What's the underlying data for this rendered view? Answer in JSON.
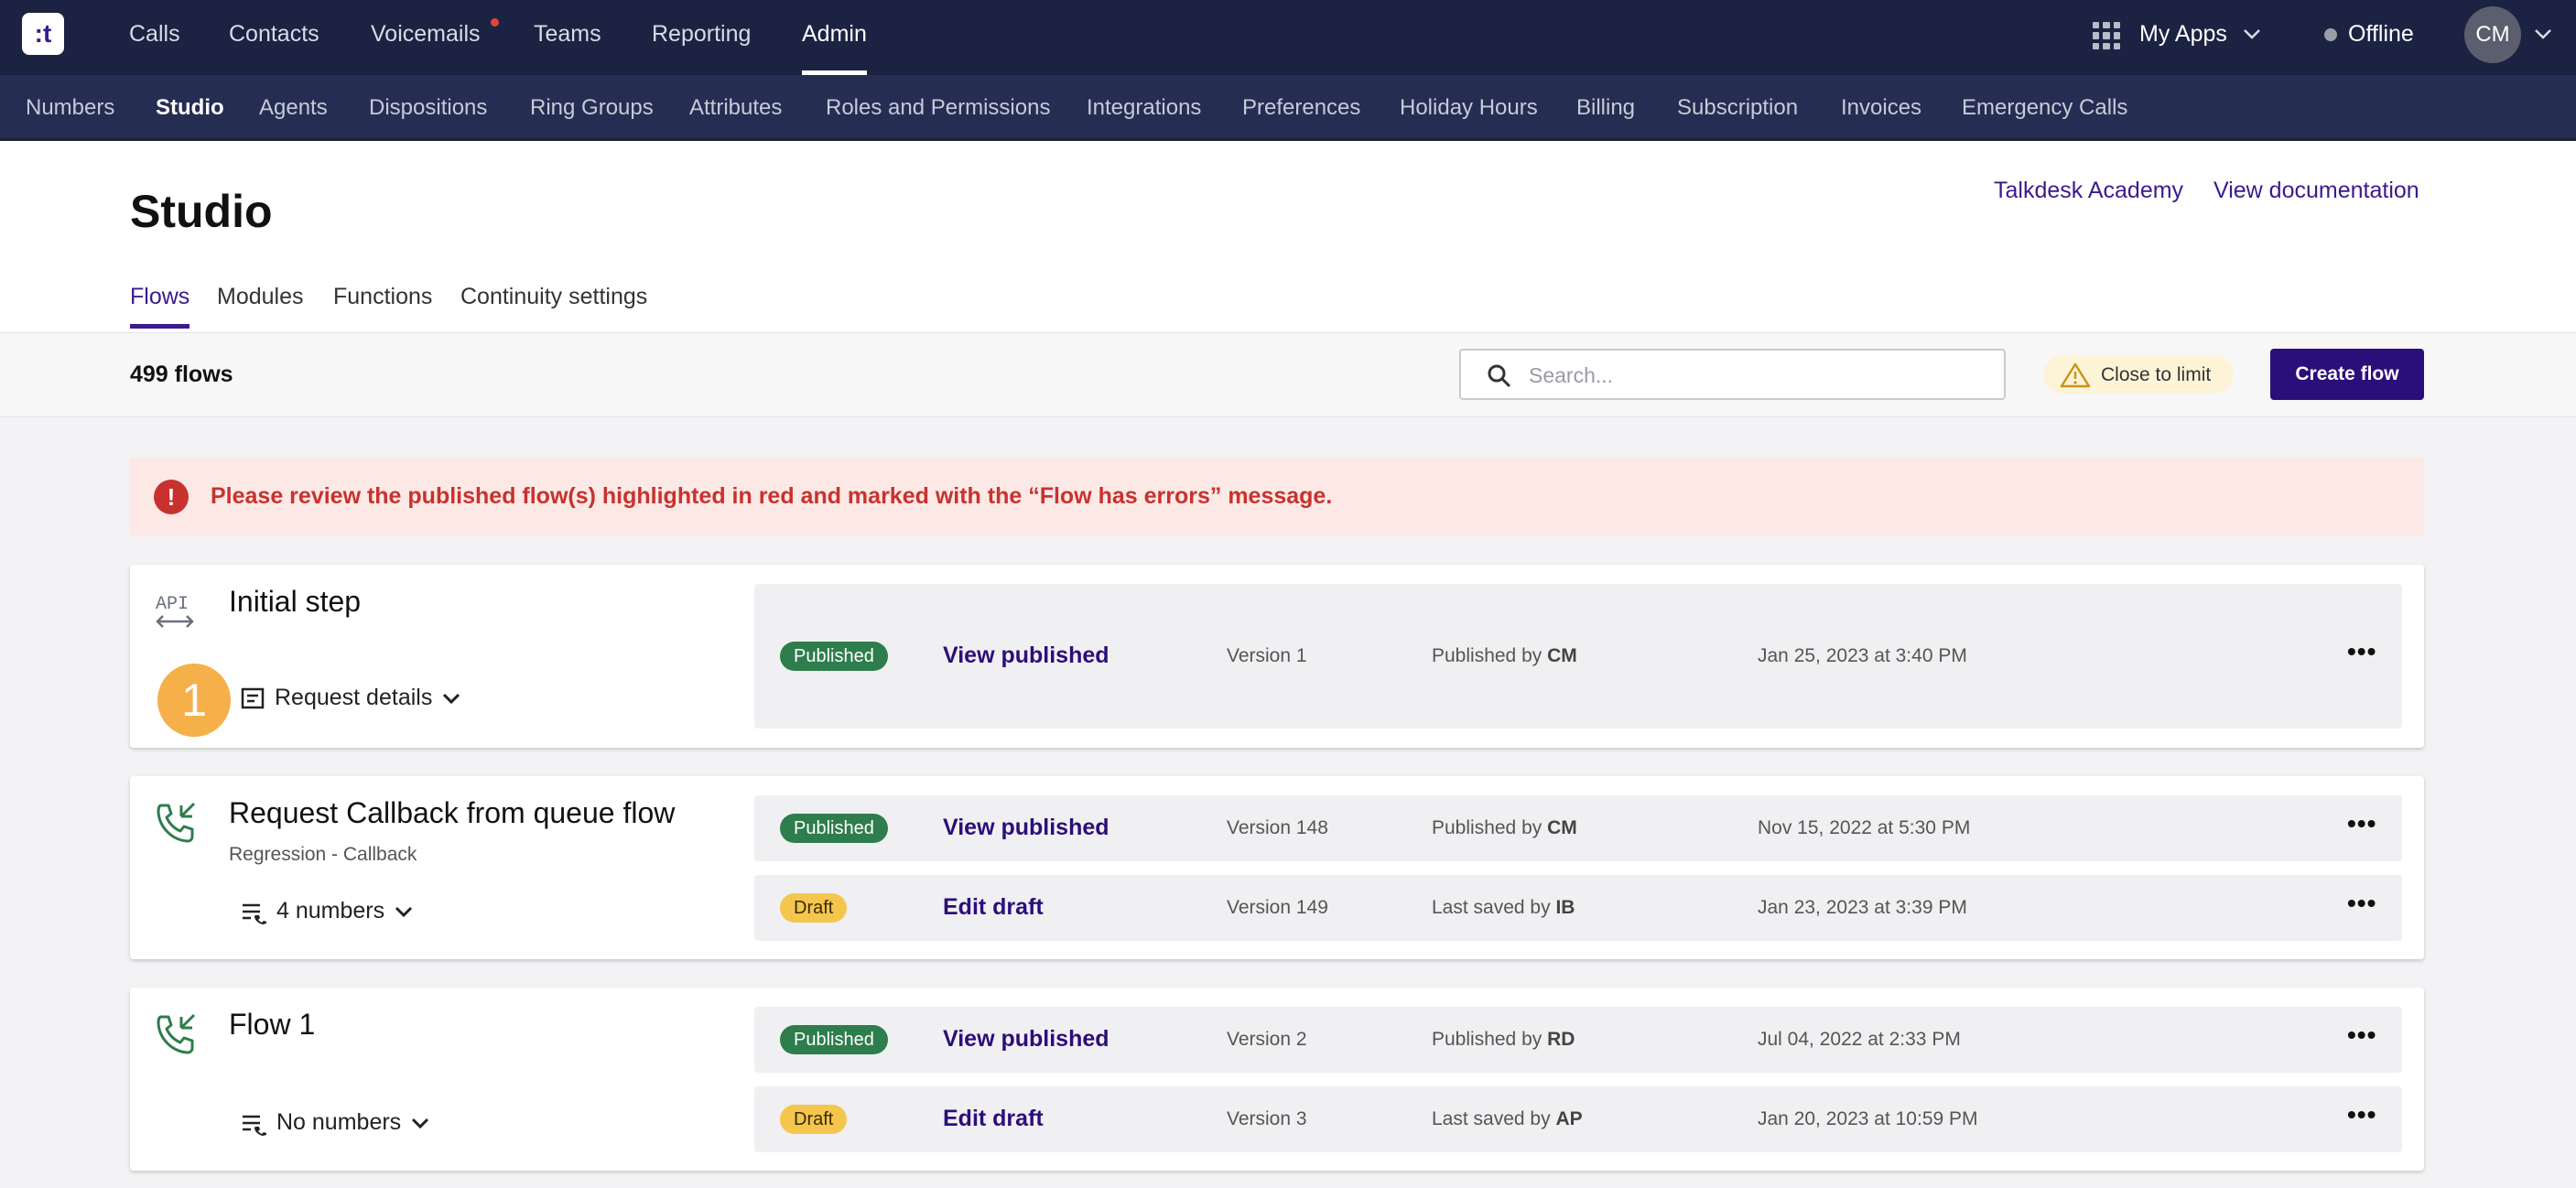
{
  "topnav": {
    "logo": ":t",
    "items": [
      "Calls",
      "Contacts",
      "Voicemails",
      "Teams",
      "Reporting",
      "Admin"
    ],
    "apps_label": "My Apps",
    "status": "Offline",
    "avatar": "CM"
  },
  "subnav": {
    "items": [
      "Numbers",
      "Studio",
      "Agents",
      "Dispositions",
      "Ring Groups",
      "Attributes",
      "Roles and Permissions",
      "Integrations",
      "Preferences",
      "Holiday Hours",
      "Billing",
      "Subscription",
      "Invoices",
      "Emergency Calls"
    ]
  },
  "page": {
    "title": "Studio",
    "academy_link": "Talkdesk Academy",
    "docs_link": "View documentation",
    "tabs": [
      "Flows",
      "Modules",
      "Functions",
      "Continuity settings"
    ]
  },
  "toolbar": {
    "count": "499 flows",
    "search_placeholder": "Search...",
    "limit_label": "Close to limit",
    "create_label": "Create flow"
  },
  "alert": {
    "message": "Please review the published flow(s) highlighted in red and marked with the “Flow has errors” message."
  },
  "flows": [
    {
      "name": "Initial step",
      "type_icon": "api-icon",
      "trigger_label": "Request details",
      "step_number": "1",
      "rows": [
        {
          "badge": "Published",
          "action": "View published",
          "version": "Version 1",
          "by_prefix": "Published by",
          "by": "CM",
          "date": "Jan 25, 2023 at 3:40 PM"
        }
      ]
    },
    {
      "name": "Request Callback from queue flow",
      "subtitle": "Regression - Callback",
      "type_icon": "phone-callback-icon",
      "numbers_label": "4 numbers",
      "rows": [
        {
          "badge": "Published",
          "action": "View published",
          "version": "Version 148",
          "by_prefix": "Published by",
          "by": "CM",
          "date": "Nov 15, 2022 at 5:30 PM"
        },
        {
          "badge": "Draft",
          "action": "Edit draft",
          "version": "Version 149",
          "by_prefix": "Last saved by",
          "by": "IB",
          "date": "Jan 23, 2023 at 3:39 PM"
        }
      ]
    },
    {
      "name": "Flow 1",
      "type_icon": "phone-callback-icon",
      "numbers_label": "No numbers",
      "rows": [
        {
          "badge": "Published",
          "action": "View published",
          "version": "Version 2",
          "by_prefix": "Published by",
          "by": "RD",
          "date": "Jul 04, 2022 at 2:33 PM"
        },
        {
          "badge": "Draft",
          "action": "Edit draft",
          "version": "Version 3",
          "by_prefix": "Last saved by",
          "by": "AP",
          "date": "Jan 20, 2023 at 10:59 PM"
        }
      ]
    }
  ],
  "colors": {
    "nav_bg": "#1c2242",
    "subnav_bg": "#262d52",
    "accent": "#2c0e7a",
    "published": "#2e7d4c",
    "draft": "#f4c64e",
    "error": "#c8322e"
  }
}
